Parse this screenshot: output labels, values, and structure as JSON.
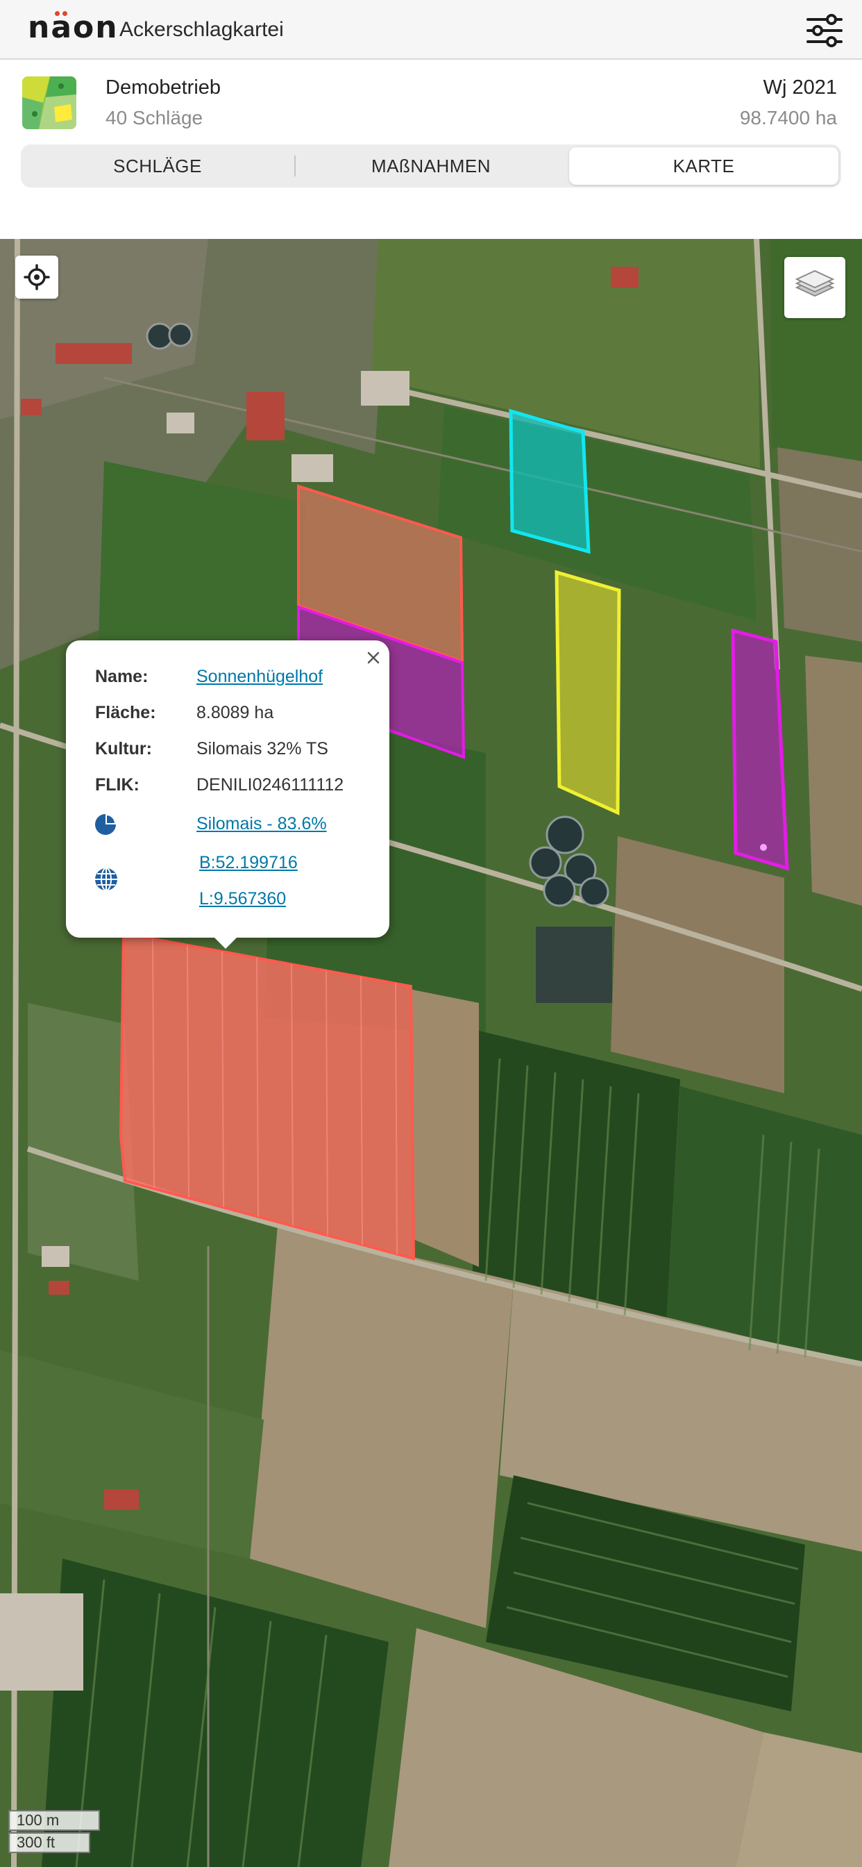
{
  "app": {
    "logo_text": "nаon",
    "title": "Ackerschlagkartei"
  },
  "farm": {
    "name": "Demobetrieb",
    "count": "40 Schläge",
    "year": "Wj 2021",
    "area": "98.7400 ha"
  },
  "tabs": [
    {
      "label": "SCHLÄGE"
    },
    {
      "label": "MAßNAHMEN"
    },
    {
      "label": "KARTE",
      "active": true
    }
  ],
  "popup": {
    "name_label": "Name:",
    "name_value": "Sonnenhügelhof",
    "area_label": "Fläche:",
    "area_value": "8.8089 ha",
    "crop_label": "Kultur:",
    "crop_value": "Silomais 32% TS",
    "flik_label": "FLIK:",
    "flik_value": "DENILI0246111112",
    "share_link": "Silomais - 83.6%",
    "lat": "B:52.199716",
    "lon": "L:9.567360"
  },
  "scale": {
    "metric": "100 m",
    "imperial": "300 ft"
  },
  "colors": {
    "field_salmon": "#ff7a6e",
    "field_purple": "#c020c8",
    "field_cyan": "#12e6f0",
    "field_yellow": "#e2e22a",
    "field_magenta": "#e21ce6",
    "link": "#0078a8"
  },
  "icons": [
    "filter-sliders-icon",
    "locate-icon",
    "layers-icon",
    "close-icon",
    "pie-chart-icon",
    "globe-icon"
  ]
}
